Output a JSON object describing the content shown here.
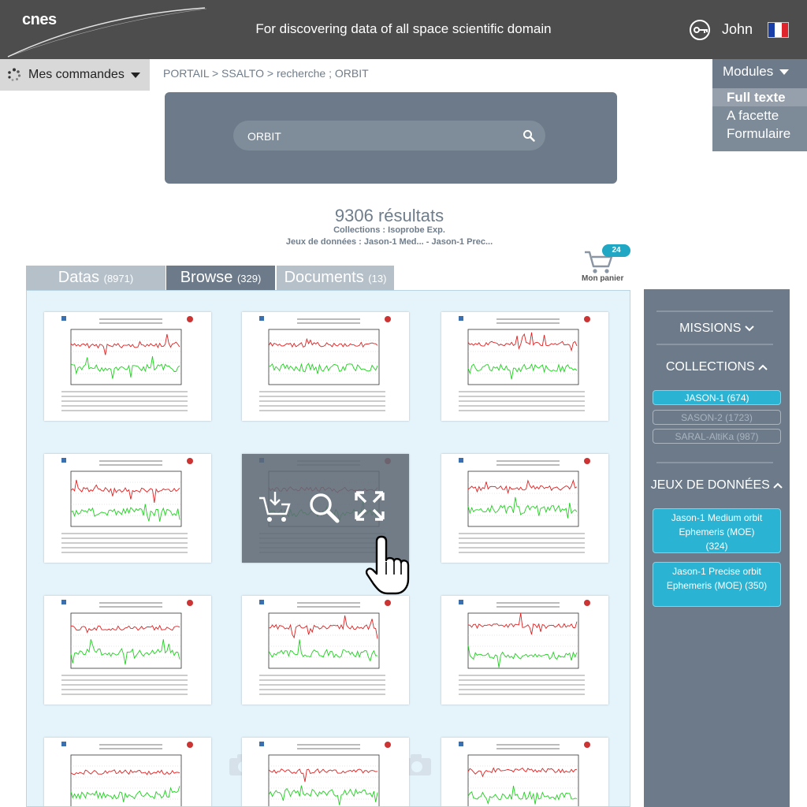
{
  "header": {
    "logo": "cnes",
    "tagline": "For discovering data of all space scientific domain",
    "user": "John"
  },
  "orders": {
    "label": "Mes commandes"
  },
  "breadcrumb": "PORTAIL > SSALTO > recherche ; ORBIT",
  "modules": {
    "label": "Modules",
    "items": [
      "Full texte",
      "A facette",
      "Formulaire"
    ]
  },
  "search": {
    "value": "ORBIT"
  },
  "results": {
    "count": "9306 résultats",
    "collections": "Collections : Isoprobe Exp.",
    "datasets": "Jeux de données : Jason-1 Med... - Jason-1 Prec..."
  },
  "cart": {
    "count": "24",
    "label": "Mon panier"
  },
  "tabs": [
    {
      "label": "Datas",
      "count": "(8971)"
    },
    {
      "label": "Browse",
      "count": "(329)"
    },
    {
      "label": "Documents",
      "count": "(13)"
    }
  ],
  "facets": {
    "missions": "MISSIONS",
    "collections": "COLLECTIONS",
    "collection_items": [
      "JASON-1 (674)",
      "SASON-2 (1723)",
      "SARAL-AltiKa (987)"
    ],
    "datasets": "JEUX DE DONNÉES",
    "dataset_items": [
      [
        "Jason-1 Medium orbit",
        "Ephemeris (MOE)",
        "(324)"
      ],
      [
        "Jason-1 Precise orbit",
        "Ephemeris (MOE) (350)"
      ]
    ]
  },
  "colors": {
    "header": "#4d4d4d",
    "panel": "#6c7a89",
    "accent": "#2ab3d2",
    "grid_bg": "#e5f3fb"
  },
  "icons": {
    "header": [
      "key-login-icon",
      "france-flag-icon"
    ],
    "overlay": [
      "add-to-cart-icon",
      "zoom-icon",
      "fullscreen-icon"
    ],
    "cart": "shopping-cart-icon"
  }
}
